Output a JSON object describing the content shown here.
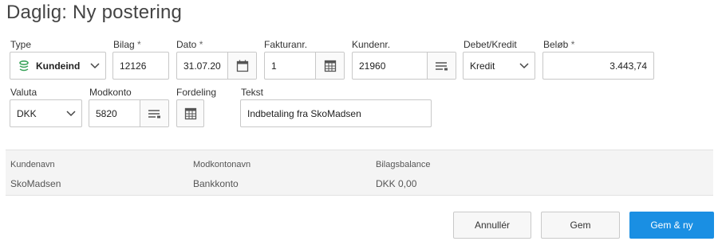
{
  "page": {
    "title": "Daglig: Ny postering"
  },
  "form": {
    "type": {
      "label": "Type",
      "value": "Kundeind"
    },
    "bilag": {
      "label": "Bilag",
      "required_mark": "*",
      "value": "12126"
    },
    "dato": {
      "label": "Dato",
      "required_mark": "*",
      "value": "31.07.20"
    },
    "fakturanr": {
      "label": "Fakturanr.",
      "value": "1"
    },
    "kundenr": {
      "label": "Kundenr.",
      "value": "21960"
    },
    "debet_kredit": {
      "label": "Debet/Kredit",
      "value": "Kredit"
    },
    "belob": {
      "label": "Beløb",
      "required_mark": "*",
      "value": "3.443,74"
    },
    "valuta": {
      "label": "Valuta",
      "value": "DKK"
    },
    "modkonto": {
      "label": "Modkonto",
      "value": "5820"
    },
    "fordeling": {
      "label": "Fordeling"
    },
    "tekst": {
      "label": "Tekst",
      "value": "Indbetaling fra SkoMadsen"
    }
  },
  "info": {
    "kundenavn": {
      "label": "Kundenavn",
      "value": "SkoMadsen"
    },
    "modkontonavn": {
      "label": "Modkontonavn",
      "value": "Bankkonto"
    },
    "bilagsbalance": {
      "label": "Bilagsbalance",
      "value": "DKK 0,00"
    }
  },
  "actions": {
    "cancel": "Annullér",
    "save": "Gem",
    "save_new": "Gem & ny"
  },
  "icons": {
    "type": "coins-icon",
    "calendar": "calendar-icon",
    "lookup": "list-lookup-icon",
    "grid": "grid-table-icon",
    "chevron": "chevron-down-icon"
  },
  "colors": {
    "primary": "#1a8fe3",
    "coins": "#3aa35b"
  }
}
